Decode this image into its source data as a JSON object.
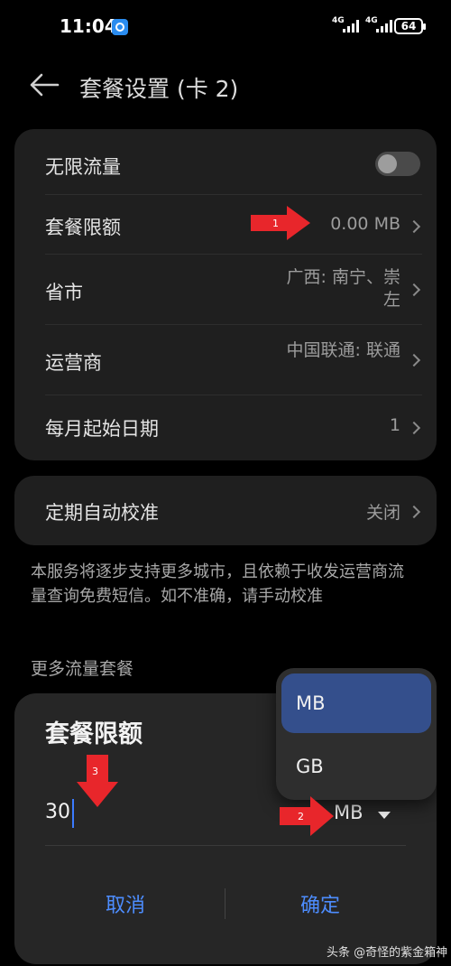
{
  "status_bar": {
    "time": "11:04",
    "sim1_tag": "4G",
    "sim2_tag": "4G",
    "battery": "64"
  },
  "header": {
    "title": "套餐设置 (卡 2)"
  },
  "settings": {
    "unlimited": {
      "label": "无限流量",
      "enabled": false
    },
    "plan_limit": {
      "label": "套餐限额",
      "value": "0.00 MB"
    },
    "province": {
      "label": "省市",
      "value_line1": "广西: 南宁、崇",
      "value_line2": "左"
    },
    "carrier": {
      "label": "运营商",
      "value": "中国联通: 联通"
    },
    "start_day": {
      "label": "每月起始日期",
      "value": "1"
    }
  },
  "auto_calibrate": {
    "label": "定期自动校准",
    "value": "关闭"
  },
  "note": "本服务将逐步支持更多城市，且依赖于收发运营商流量查询免费短信。如不准确，请手动校准",
  "more_plans": {
    "label": "更多流量套餐"
  },
  "dialog": {
    "title": "套餐限额",
    "amount": "30",
    "unit": "MB",
    "cancel": "取消",
    "confirm": "确定"
  },
  "unit_dropdown": {
    "options": [
      "MB",
      "GB"
    ],
    "selected": "MB"
  },
  "annotations": {
    "arrow1": "1",
    "arrow2": "2",
    "arrow3": "3"
  },
  "watermark": "头条 @奇怪的紫金箱神",
  "colors": {
    "accent": "#4d8dff",
    "selected_option": "#344f8c",
    "arrow": "#e8262b"
  }
}
